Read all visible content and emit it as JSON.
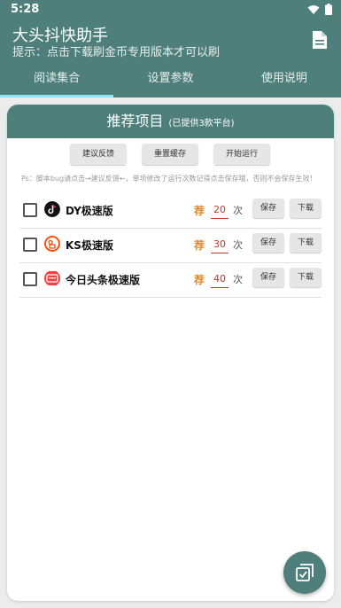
{
  "status_bar": {
    "time": "5:28"
  },
  "header": {
    "title": "大头抖快助手",
    "subtitle": "提示：点击下载刷金币专用版本才可以刷"
  },
  "tabs": [
    {
      "label": "阅读集合",
      "active": true
    },
    {
      "label": "设置参数",
      "active": false
    },
    {
      "label": "使用说明",
      "active": false
    }
  ],
  "card": {
    "title": "推荐项目",
    "subtitle": "(已提供3款平台)",
    "buttons": {
      "feedback": "建议反馈",
      "reset_cache": "重置缓存",
      "start": "开始运行"
    },
    "hint": "Ps：脚本bug请点击→建议反馈←，单项修改了运行次数记得点击保存哦，否则不会保存生效！"
  },
  "apps": [
    {
      "name": "DY极速版",
      "badge": "荐",
      "count": "20",
      "unit": "次",
      "save": "保存",
      "download": "下载",
      "icon": "tiktok-icon"
    },
    {
      "name": "KS极速版",
      "badge": "荐",
      "count": "30",
      "unit": "次",
      "save": "保存",
      "download": "下载",
      "icon": "kuaishou-icon"
    },
    {
      "name": "今日头条极速版",
      "badge": "荐",
      "count": "40",
      "unit": "次",
      "save": "保存",
      "download": "下载",
      "icon": "toutiao-icon"
    }
  ],
  "colors": {
    "primary": "#4f7f7a",
    "tab_indicator": "#8ee3ff",
    "badge": "#e0872a",
    "count": "#c0392b"
  }
}
